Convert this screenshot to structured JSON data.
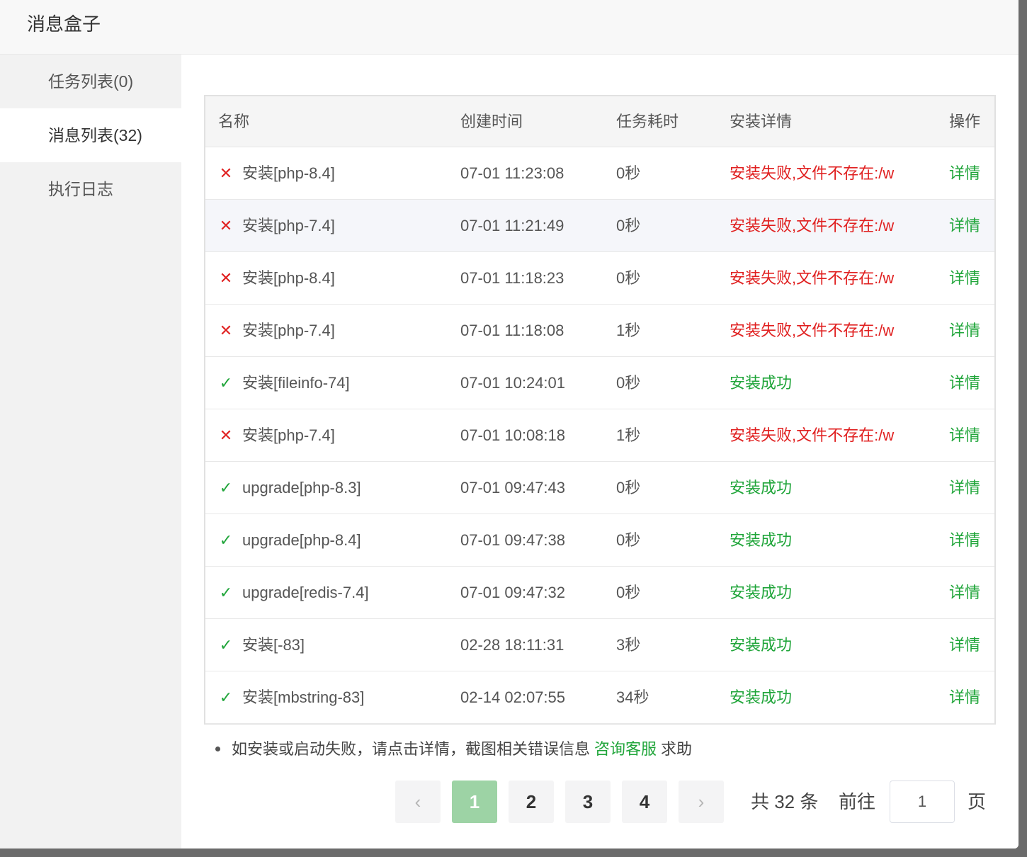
{
  "header": {
    "title": "消息盒子"
  },
  "sidebar": {
    "items": [
      {
        "label": "任务列表(0)"
      },
      {
        "label": "消息列表(32)"
      },
      {
        "label": "执行日志"
      }
    ]
  },
  "table": {
    "columns": [
      "名称",
      "创建时间",
      "任务耗时",
      "安装详情",
      "操作"
    ],
    "rows": [
      {
        "status": "fail",
        "name": "安装[php-8.4]",
        "time": "07-01 11:23:08",
        "cost": "0秒",
        "detail": "安装失败,文件不存在:/w",
        "op": "详情"
      },
      {
        "status": "fail",
        "name": "安装[php-7.4]",
        "time": "07-01 11:21:49",
        "cost": "0秒",
        "detail": "安装失败,文件不存在:/w",
        "op": "详情"
      },
      {
        "status": "fail",
        "name": "安装[php-8.4]",
        "time": "07-01 11:18:23",
        "cost": "0秒",
        "detail": "安装失败,文件不存在:/w",
        "op": "详情"
      },
      {
        "status": "fail",
        "name": "安装[php-7.4]",
        "time": "07-01 11:18:08",
        "cost": "1秒",
        "detail": "安装失败,文件不存在:/w",
        "op": "详情"
      },
      {
        "status": "ok",
        "name": "安装[fileinfo-74]",
        "time": "07-01 10:24:01",
        "cost": "0秒",
        "detail": "安装成功",
        "op": "详情"
      },
      {
        "status": "fail",
        "name": "安装[php-7.4]",
        "time": "07-01 10:08:18",
        "cost": "1秒",
        "detail": "安装失败,文件不存在:/w",
        "op": "详情"
      },
      {
        "status": "ok",
        "name": "upgrade[php-8.3]",
        "time": "07-01 09:47:43",
        "cost": "0秒",
        "detail": "安装成功",
        "op": "详情"
      },
      {
        "status": "ok",
        "name": "upgrade[php-8.4]",
        "time": "07-01 09:47:38",
        "cost": "0秒",
        "detail": "安装成功",
        "op": "详情"
      },
      {
        "status": "ok",
        "name": "upgrade[redis-7.4]",
        "time": "07-01 09:47:32",
        "cost": "0秒",
        "detail": "安装成功",
        "op": "详情"
      },
      {
        "status": "ok",
        "name": "安装[-83]",
        "time": "02-28 18:11:31",
        "cost": "3秒",
        "detail": "安装成功",
        "op": "详情"
      },
      {
        "status": "ok",
        "name": "安装[mbstring-83]",
        "time": "02-14 02:07:55",
        "cost": "34秒",
        "detail": "安装成功",
        "op": "详情"
      }
    ]
  },
  "note": {
    "text": "如安装或启动失败，请点击详情，截图相关错误信息",
    "link": "咨询客服",
    "suffix": "求助"
  },
  "pagination": {
    "prev": "‹",
    "next": "›",
    "pages": [
      "1",
      "2",
      "3",
      "4"
    ],
    "current": "1",
    "total_text": "共 32 条",
    "goto_label": "前往",
    "goto_value": "1",
    "page_suffix": "页"
  },
  "colors": {
    "success": "#20a53a",
    "error": "#e02020",
    "active_page": "#9dd3a5"
  },
  "icons": {
    "fail": "close-icon",
    "ok": "check-icon"
  }
}
